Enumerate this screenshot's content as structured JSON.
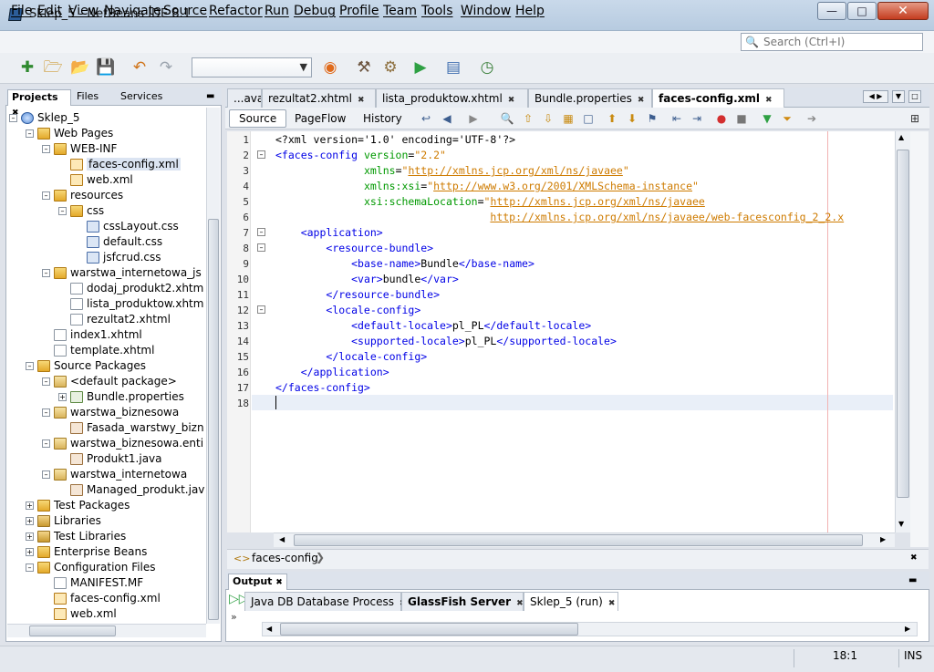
{
  "window": {
    "title": "Sklep_5 - NetBeans IDE 8.1"
  },
  "menu": [
    "File",
    "Edit",
    "View",
    "Navigate",
    "Source",
    "Refactor",
    "Run",
    "Debug",
    "Profile",
    "Team",
    "Tools",
    "Window",
    "Help"
  ],
  "search": {
    "placeholder": "Search (Ctrl+I)"
  },
  "left_tabs": {
    "projects": "Projects",
    "files": "Files",
    "services": "Services"
  },
  "tree": [
    {
      "label": "Sklep_5",
      "depth": 0,
      "icon": "project-icon",
      "exp": "-"
    },
    {
      "label": "Web Pages",
      "depth": 1,
      "icon": "folder-icon",
      "exp": "-"
    },
    {
      "label": "WEB-INF",
      "depth": 2,
      "icon": "folder-icon",
      "exp": "-"
    },
    {
      "label": "faces-config.xml",
      "depth": 3,
      "icon": "xml-file-icon",
      "exp": "",
      "selected": true
    },
    {
      "label": "web.xml",
      "depth": 3,
      "icon": "xml-file-icon",
      "exp": ""
    },
    {
      "label": "resources",
      "depth": 2,
      "icon": "folder-icon",
      "exp": "-"
    },
    {
      "label": "css",
      "depth": 3,
      "icon": "folder-icon",
      "exp": "-"
    },
    {
      "label": "cssLayout.css",
      "depth": 4,
      "icon": "css-file-icon",
      "exp": ""
    },
    {
      "label": "default.css",
      "depth": 4,
      "icon": "css-file-icon",
      "exp": ""
    },
    {
      "label": "jsfcrud.css",
      "depth": 4,
      "icon": "css-file-icon",
      "exp": ""
    },
    {
      "label": "warstwa_internetowa_js",
      "depth": 2,
      "icon": "folder-icon",
      "exp": "-"
    },
    {
      "label": "dodaj_produkt2.xhtm",
      "depth": 3,
      "icon": "file-icon",
      "exp": ""
    },
    {
      "label": "lista_produktow.xhtm",
      "depth": 3,
      "icon": "file-icon",
      "exp": ""
    },
    {
      "label": "rezultat2.xhtml",
      "depth": 3,
      "icon": "file-icon",
      "exp": ""
    },
    {
      "label": "index1.xhtml",
      "depth": 2,
      "icon": "file-icon",
      "exp": ""
    },
    {
      "label": "template.xhtml",
      "depth": 2,
      "icon": "file-icon",
      "exp": ""
    },
    {
      "label": "Source Packages",
      "depth": 1,
      "icon": "folder-icon",
      "exp": "-"
    },
    {
      "label": "<default package>",
      "depth": 2,
      "icon": "package-icon",
      "exp": "-"
    },
    {
      "label": "Bundle.properties",
      "depth": 3,
      "icon": "properties-file-icon",
      "exp": "+"
    },
    {
      "label": "warstwa_biznesowa",
      "depth": 2,
      "icon": "package-icon",
      "exp": "-"
    },
    {
      "label": "Fasada_warstwy_bizn",
      "depth": 3,
      "icon": "java-file-icon",
      "exp": ""
    },
    {
      "label": "warstwa_biznesowa.enti",
      "depth": 2,
      "icon": "package-icon",
      "exp": "-"
    },
    {
      "label": "Produkt1.java",
      "depth": 3,
      "icon": "java-file-icon",
      "exp": ""
    },
    {
      "label": "warstwa_internetowa",
      "depth": 2,
      "icon": "package-icon",
      "exp": "-"
    },
    {
      "label": "Managed_produkt.jav",
      "depth": 3,
      "icon": "java-file-icon",
      "exp": ""
    },
    {
      "label": "Test Packages",
      "depth": 1,
      "icon": "folder-icon",
      "exp": "+"
    },
    {
      "label": "Libraries",
      "depth": 1,
      "icon": "library-icon",
      "exp": "+"
    },
    {
      "label": "Test Libraries",
      "depth": 1,
      "icon": "library-icon",
      "exp": "+"
    },
    {
      "label": "Enterprise Beans",
      "depth": 1,
      "icon": "folder-icon",
      "exp": "+"
    },
    {
      "label": "Configuration Files",
      "depth": 1,
      "icon": "folder-icon",
      "exp": "-"
    },
    {
      "label": "MANIFEST.MF",
      "depth": 2,
      "icon": "manifest-file-icon",
      "exp": ""
    },
    {
      "label": "faces-config.xml",
      "depth": 2,
      "icon": "xml-file-icon",
      "exp": ""
    },
    {
      "label": "web.xml",
      "depth": 2,
      "icon": "xml-file-icon",
      "exp": ""
    }
  ],
  "editor_tabs": [
    {
      "label": "...ava",
      "close": false
    },
    {
      "label": "rezultat2.xhtml",
      "close": true
    },
    {
      "label": "lista_produktow.xhtml",
      "close": true
    },
    {
      "label": "Bundle.properties",
      "close": true
    },
    {
      "label": "faces-config.xml",
      "close": true,
      "active": true
    }
  ],
  "editor_views": {
    "source": "Source",
    "pageflow": "PageFlow",
    "history": "History"
  },
  "code_lines": [
    [
      [
        "p",
        "<?xml version='1.0' encoding='UTF-8'?>"
      ]
    ],
    [
      [
        "t",
        "<faces-config "
      ],
      [
        "a",
        "version"
      ],
      [
        "p",
        "="
      ],
      [
        "v",
        "\"2.2\""
      ]
    ],
    [
      [
        "p",
        "              "
      ],
      [
        "a",
        "xmlns"
      ],
      [
        "p",
        "="
      ],
      [
        "v",
        "\""
      ],
      [
        "u",
        "http://xmlns.jcp.org/xml/ns/javaee"
      ],
      [
        "v",
        "\""
      ]
    ],
    [
      [
        "p",
        "              "
      ],
      [
        "a",
        "xmlns:xsi"
      ],
      [
        "p",
        "="
      ],
      [
        "v",
        "\""
      ],
      [
        "u",
        "http://www.w3.org/2001/XMLSchema-instance"
      ],
      [
        "v",
        "\""
      ]
    ],
    [
      [
        "p",
        "              "
      ],
      [
        "a",
        "xsi:schemaLocation"
      ],
      [
        "p",
        "="
      ],
      [
        "v",
        "\""
      ],
      [
        "u",
        "http://xmlns.jcp.org/xml/ns/javaee"
      ]
    ],
    [
      [
        "p",
        "                                  "
      ],
      [
        "u",
        "http://xmlns.jcp.org/xml/ns/javaee/web-facesconfig_2_2.x"
      ]
    ],
    [
      [
        "p",
        "    "
      ],
      [
        "t",
        "<application>"
      ]
    ],
    [
      [
        "p",
        "        "
      ],
      [
        "t",
        "<resource-bundle>"
      ]
    ],
    [
      [
        "p",
        "            "
      ],
      [
        "t",
        "<base-name>"
      ],
      [
        "p",
        "Bundle"
      ],
      [
        "t",
        "</base-name>"
      ]
    ],
    [
      [
        "p",
        "            "
      ],
      [
        "t",
        "<var>"
      ],
      [
        "p",
        "bundle"
      ],
      [
        "t",
        "</var>"
      ]
    ],
    [
      [
        "p",
        "        "
      ],
      [
        "t",
        "</resource-bundle>"
      ]
    ],
    [
      [
        "p",
        "        "
      ],
      [
        "t",
        "<locale-config>"
      ]
    ],
    [
      [
        "p",
        "            "
      ],
      [
        "t",
        "<default-locale>"
      ],
      [
        "p",
        "pl_PL"
      ],
      [
        "t",
        "</default-locale>"
      ]
    ],
    [
      [
        "p",
        "            "
      ],
      [
        "t",
        "<supported-locale>"
      ],
      [
        "p",
        "pl_PL"
      ],
      [
        "t",
        "</supported-locale>"
      ]
    ],
    [
      [
        "p",
        "        "
      ],
      [
        "t",
        "</locale-config>"
      ]
    ],
    [
      [
        "p",
        "    "
      ],
      [
        "t",
        "</application>"
      ]
    ],
    [
      [
        "t",
        "</faces-config>"
      ]
    ],
    []
  ],
  "breadcrumb": {
    "label": "faces-config"
  },
  "output": {
    "title": "Output",
    "tabs": [
      {
        "label": "Java DB Database Process",
        "bold": false
      },
      {
        "label": "GlassFish Server",
        "bold": true
      },
      {
        "label": "Sklep_5 (run)",
        "bold": false,
        "active": true
      }
    ]
  },
  "status": {
    "position": "18:1",
    "mode": "INS"
  }
}
